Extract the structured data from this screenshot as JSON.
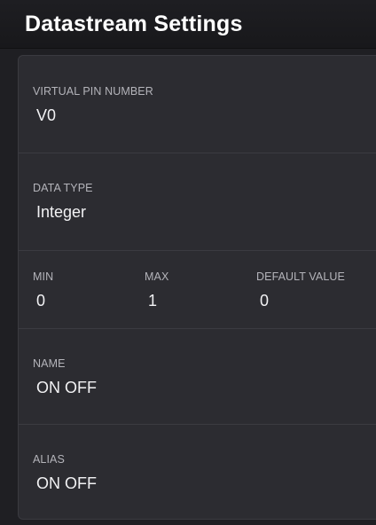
{
  "header": {
    "title": "Datastream Settings"
  },
  "settings": {
    "virtual_pin": {
      "label": "VIRTUAL PIN NUMBER",
      "value": "V0"
    },
    "data_type": {
      "label": "DATA TYPE",
      "value": "Integer"
    },
    "min": {
      "label": "MIN",
      "value": "0"
    },
    "max": {
      "label": "MAX",
      "value": "1"
    },
    "default_value": {
      "label": "DEFAULT VALUE",
      "value": "0"
    },
    "name": {
      "label": "NAME",
      "value": "ON OFF"
    },
    "alias": {
      "label": "ALIAS",
      "value": "ON OFF"
    }
  },
  "colors": {
    "background": "#1f1f23",
    "panel": "#2c2c31",
    "label_text": "#b4b4ba",
    "value_text": "#f2f2f4"
  }
}
